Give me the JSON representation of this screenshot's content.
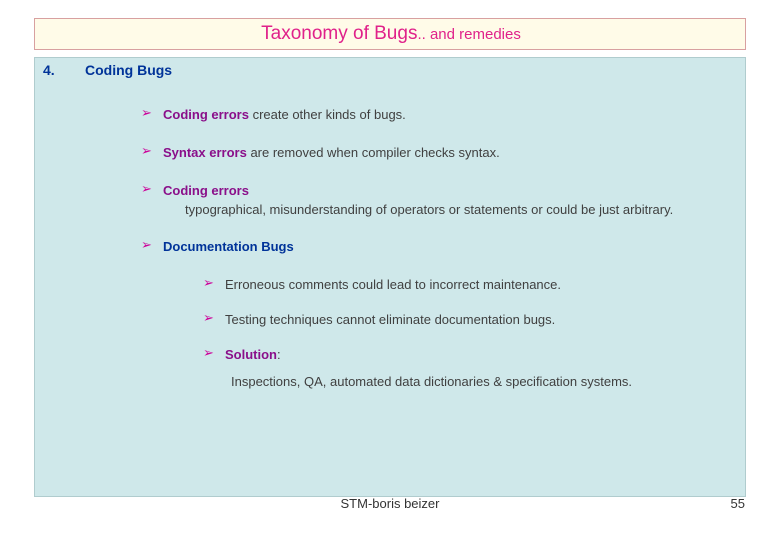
{
  "title": {
    "main": "Taxonomy of Bugs",
    "sub": ".. and remedies"
  },
  "section": {
    "number": "4.",
    "heading": "Coding Bugs"
  },
  "bullets": [
    {
      "marker": "➢",
      "level": 1,
      "highlight": "Coding errors",
      "rest": " create other kinds of bugs.",
      "highlight_color": "purple"
    },
    {
      "marker": "➢",
      "level": 1,
      "highlight": "Syntax errors",
      "rest": " are removed when compiler checks syntax.",
      "highlight_color": "purple"
    },
    {
      "marker": "➢",
      "level": 1,
      "highlight": "Coding errors",
      "rest": "",
      "highlight_color": "purple",
      "subline": "typographical, misunderstanding of operators or statements or could be just arbitrary."
    },
    {
      "marker": "➢",
      "level": 1,
      "highlight": "Documentation Bugs",
      "rest": "",
      "highlight_color": "blue"
    },
    {
      "marker": "➢",
      "level": 2,
      "highlight": "",
      "rest": "Erroneous comments could lead to incorrect maintenance.",
      "highlight_color": "none"
    },
    {
      "marker": "➢",
      "level": 2,
      "highlight": "",
      "rest": "Testing techniques cannot eliminate documentation bugs.",
      "highlight_color": "none"
    },
    {
      "marker": "➢",
      "level": 2,
      "highlight": "Solution",
      "rest": ":",
      "highlight_color": "purple"
    }
  ],
  "closing_line": "Inspections, QA, automated data dictionaries & specification systems.",
  "footer": {
    "center": "STM-boris beizer",
    "page": "55"
  }
}
